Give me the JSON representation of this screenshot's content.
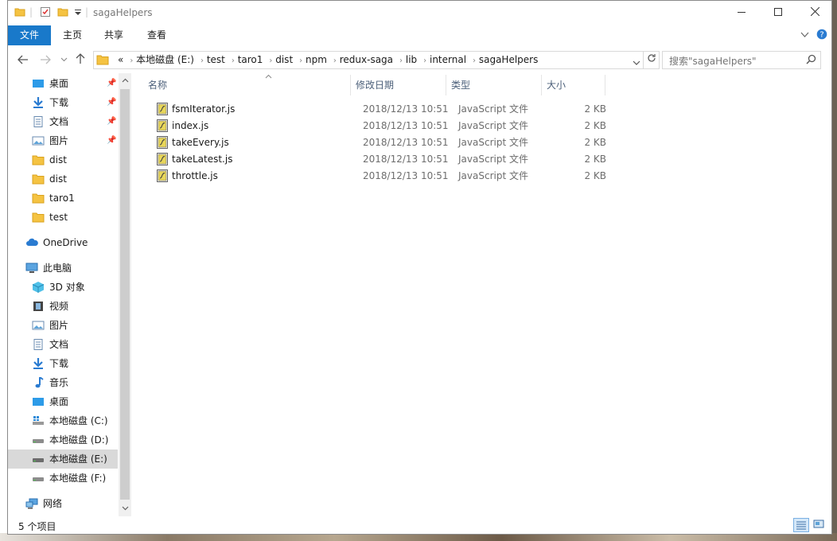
{
  "window": {
    "title": "sagaHelpers",
    "quick_access_icons": [
      "folder-icon",
      "properties-check-icon",
      "new-folder-icon",
      "customize-dropdown-icon"
    ],
    "controls": {
      "minimize": "minimize-icon",
      "maximize": "maximize-icon",
      "close": "close-icon"
    }
  },
  "ribbon": {
    "tabs": [
      {
        "label": "文件",
        "active": true
      },
      {
        "label": "主页"
      },
      {
        "label": "共享"
      },
      {
        "label": "查看"
      }
    ],
    "expand_icon": "chevron-down-icon",
    "help_icon": "help-icon",
    "help_text": "?"
  },
  "address": {
    "overflow": "«",
    "crumbs": [
      "本地磁盘 (E:)",
      "test",
      "taro1",
      "dist",
      "npm",
      "redux-saga",
      "lib",
      "internal",
      "sagaHelpers"
    ]
  },
  "search": {
    "placeholder": "搜索\"sagaHelpers\""
  },
  "nav": {
    "quick_access": [
      {
        "label": "桌面",
        "icon": "desktop-icon",
        "pinned": true
      },
      {
        "label": "下载",
        "icon": "download-arrow-icon",
        "pinned": true
      },
      {
        "label": "文档",
        "icon": "document-icon",
        "pinned": true
      },
      {
        "label": "图片",
        "icon": "pictures-icon",
        "pinned": true
      },
      {
        "label": "dist",
        "icon": "folder-icon"
      },
      {
        "label": "dist",
        "icon": "folder-icon"
      },
      {
        "label": "taro1",
        "icon": "folder-icon"
      },
      {
        "label": "test",
        "icon": "folder-icon"
      }
    ],
    "onedrive": {
      "label": "OneDrive",
      "icon": "cloud-icon"
    },
    "thispc": {
      "label": "此电脑",
      "icon": "computer-icon"
    },
    "pc_items": [
      {
        "label": "3D 对象",
        "icon": "cube-3d-icon"
      },
      {
        "label": "视频",
        "icon": "video-icon"
      },
      {
        "label": "图片",
        "icon": "pictures-icon"
      },
      {
        "label": "文档",
        "icon": "document-icon"
      },
      {
        "label": "下载",
        "icon": "download-arrow-icon"
      },
      {
        "label": "音乐",
        "icon": "music-note-icon"
      },
      {
        "label": "桌面",
        "icon": "desktop-icon"
      },
      {
        "label": "本地磁盘 (C:)",
        "icon": "windows-drive-icon"
      },
      {
        "label": "本地磁盘 (D:)",
        "icon": "drive-icon"
      },
      {
        "label": "本地磁盘 (E:)",
        "icon": "drive-icon",
        "selected": true
      },
      {
        "label": "本地磁盘 (F:)",
        "icon": "drive-icon"
      }
    ],
    "network": {
      "label": "网络",
      "icon": "network-icon"
    }
  },
  "columns": {
    "name": "名称",
    "date": "修改日期",
    "type": "类型",
    "size": "大小"
  },
  "files": [
    {
      "name": "fsmIterator.js",
      "date": "2018/12/13 10:51",
      "type": "JavaScript 文件",
      "size": "2 KB"
    },
    {
      "name": "index.js",
      "date": "2018/12/13 10:51",
      "type": "JavaScript 文件",
      "size": "2 KB"
    },
    {
      "name": "takeEvery.js",
      "date": "2018/12/13 10:51",
      "type": "JavaScript 文件",
      "size": "2 KB"
    },
    {
      "name": "takeLatest.js",
      "date": "2018/12/13 10:51",
      "type": "JavaScript 文件",
      "size": "2 KB"
    },
    {
      "name": "throttle.js",
      "date": "2018/12/13 10:51",
      "type": "JavaScript 文件",
      "size": "2 KB"
    }
  ],
  "status": {
    "count": "5 个项目"
  },
  "colors": {
    "accent": "#1979ca",
    "selected_nav": "#d9d9d9",
    "folder": "#f5c342"
  }
}
